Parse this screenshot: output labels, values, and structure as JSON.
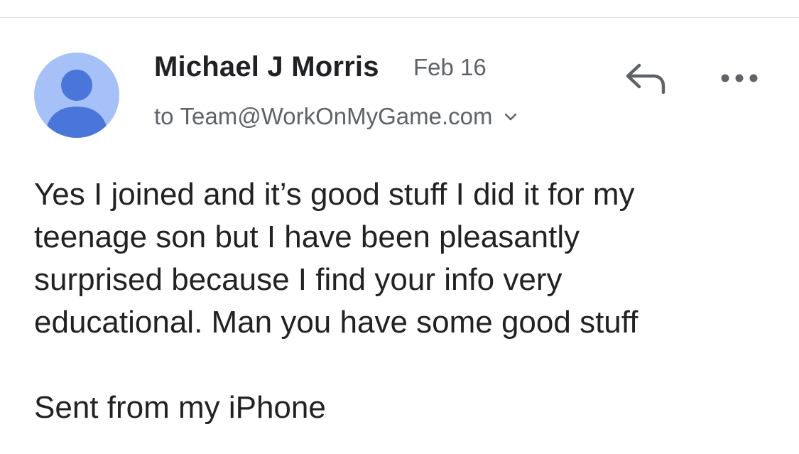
{
  "message": {
    "sender_name": "Michael J Morris",
    "date": "Feb 16",
    "recipient_prefix": "to",
    "recipient": "Team@WorkOnMyGame.com",
    "body_lines": [
      "Yes I joined and it’s good stuff I did it for my",
      "teenage son but I have been pleasantly",
      "surprised because I find your info very",
      "educational. Man you have some good stuff"
    ],
    "signature": "Sent from my iPhone"
  },
  "icons": {
    "avatar": "person-avatar-icon",
    "recipient_toggle": "chevron-down-icon",
    "reply": "reply-icon",
    "more": "more-horizontal-icon"
  },
  "colors": {
    "avatar_background": "#a6c1f7",
    "avatar_figure": "#4a76d9",
    "secondary_text": "#5f6368",
    "primary_text": "#202124"
  }
}
